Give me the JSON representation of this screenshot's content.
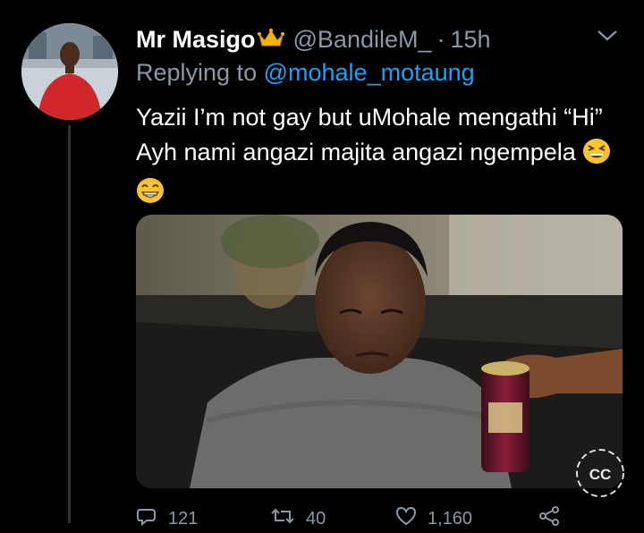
{
  "tweet": {
    "display_name": "Mr Masigo",
    "handle": "@BandileM_",
    "separator": "·",
    "time": "15h",
    "replying_prefix": "Replying to",
    "replying_to": "@mohale_motaung",
    "text": "Yazii I’m not gay but uMohale mengathi “Hi” Ayh nami angazi majita angazi ngempela",
    "emojis": [
      "grinning-squinting-face",
      "beaming-face"
    ],
    "media_alt": "",
    "actions": {
      "reply_count": "121",
      "retweet_count": "40",
      "like_count": "1,160"
    }
  },
  "watermark_text": "CC",
  "colors": {
    "background": "#000000",
    "text": "#ffffff",
    "muted": "#8b98a5",
    "accent": "#1da1f2",
    "crown": "#f5b400"
  },
  "icons": [
    "crown-icon",
    "chevron-down-icon",
    "reply-icon",
    "retweet-icon",
    "like-icon",
    "share-icon"
  ]
}
